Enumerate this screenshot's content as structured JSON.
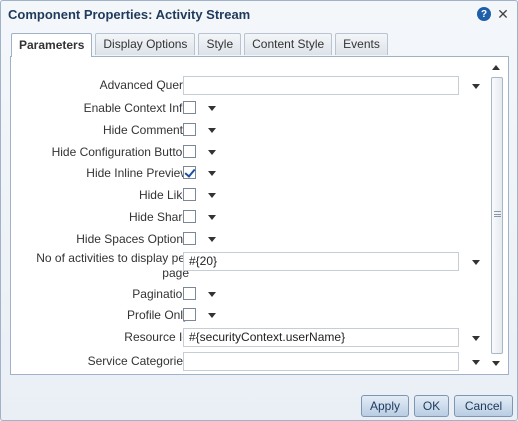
{
  "dialog": {
    "title": "Component Properties: Activity Stream",
    "help_icon": "?",
    "close_icon": "✕"
  },
  "tabs": [
    {
      "label": "Parameters",
      "active": true
    },
    {
      "label": "Display Options",
      "active": false
    },
    {
      "label": "Style",
      "active": false
    },
    {
      "label": "Content Style",
      "active": false
    },
    {
      "label": "Events",
      "active": false
    }
  ],
  "params": {
    "advanced_query": {
      "label": "Advanced Query",
      "value": ""
    },
    "enable_context_info": {
      "label": "Enable Context Info",
      "checked": false
    },
    "hide_comments": {
      "label": "Hide Comments",
      "checked": false
    },
    "hide_configuration_button": {
      "label": "Hide Configuration Button",
      "checked": false
    },
    "hide_inline_preview": {
      "label": "Hide Inline Preview",
      "checked": true
    },
    "hide_like": {
      "label": "Hide Like",
      "checked": false
    },
    "hide_share": {
      "label": "Hide Share",
      "checked": false
    },
    "hide_spaces_options": {
      "label": "Hide Spaces Options",
      "checked": false
    },
    "activities_per_page": {
      "label": "No of activities to display per page",
      "value": "#{20}"
    },
    "pagination": {
      "label": "Pagination",
      "checked": false
    },
    "profile_only": {
      "label": "Profile Only",
      "checked": false
    },
    "resource_id": {
      "label": "Resource Id",
      "value": "#{securityContext.userName}"
    },
    "service_categories": {
      "label": "Service Categories",
      "value": ""
    }
  },
  "buttons": {
    "apply": "Apply",
    "ok": "OK",
    "cancel": "Cancel"
  }
}
